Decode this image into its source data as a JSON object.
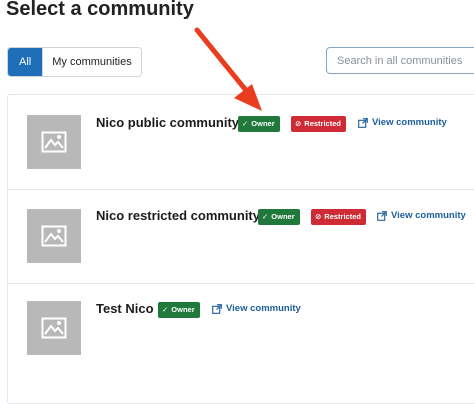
{
  "page": {
    "title": "Select a community"
  },
  "filters": {
    "all_label": "All",
    "mine_label": "My communities"
  },
  "search": {
    "placeholder": "Search in all communities"
  },
  "communities": [
    {
      "name": "Nico public community",
      "owner_label": "Owner",
      "restricted_label": "Restricted",
      "view_label": "View community"
    },
    {
      "name": "Nico restricted community",
      "owner_label": "Owner",
      "restricted_label": "Restricted",
      "view_label": "View community"
    },
    {
      "name": "Test Nico",
      "owner_label": "Owner",
      "view_label": "View community"
    }
  ],
  "colors": {
    "accent": "#1f6fb8",
    "owner": "#20783a",
    "restricted": "#cf2b34",
    "link": "#1d5e9a",
    "annotation_arrow": "#ea3d20"
  },
  "icons": {
    "thumbnail": "image-placeholder-icon",
    "owner": "check-icon",
    "restricted": "ban-icon",
    "view": "external-link-icon"
  }
}
